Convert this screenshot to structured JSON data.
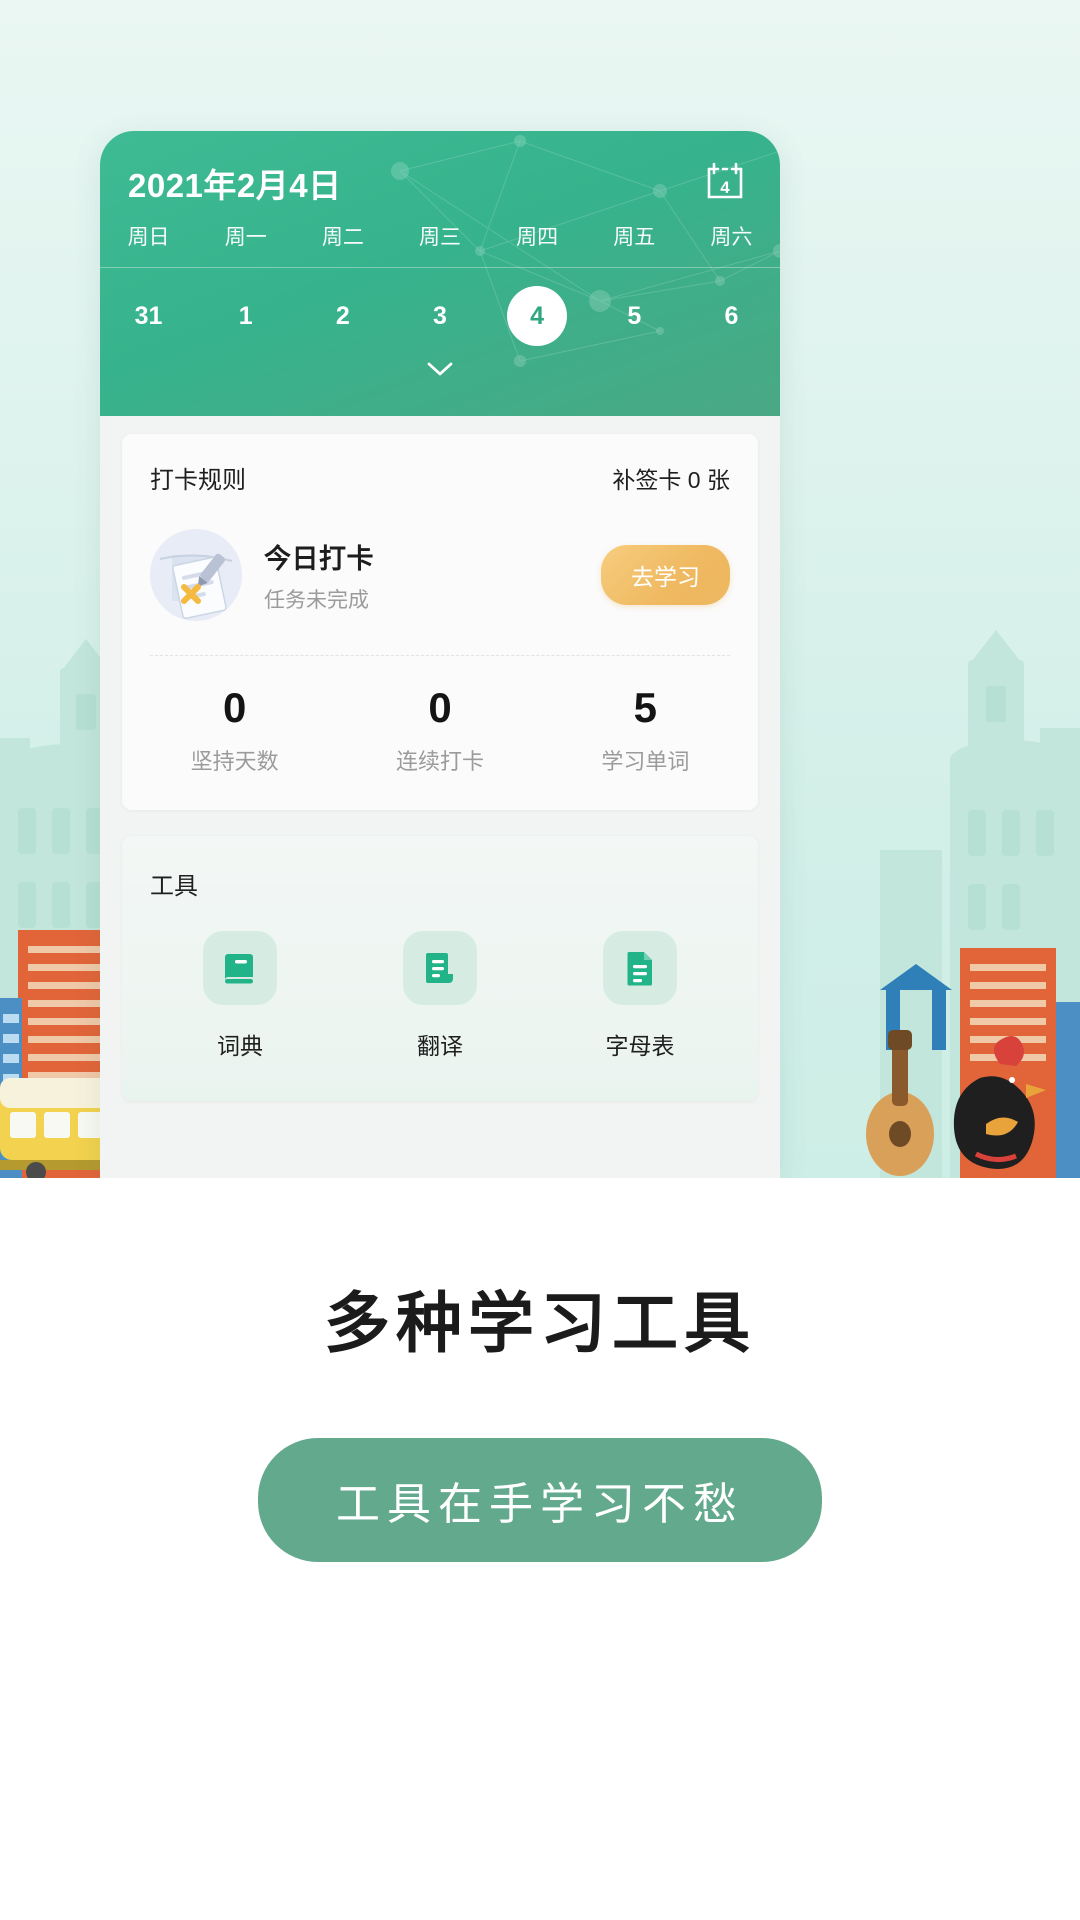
{
  "colors": {
    "header_green": "#36b38c",
    "accent_yellow": "#efb961",
    "tool_green": "#2fb98a",
    "promo_green": "#62a98e",
    "page_bg": "#f2f4f3"
  },
  "header": {
    "date_title": "2021年2月4日",
    "calendar_icon_label": "calendar-icon",
    "calendar_icon_day": "4",
    "weekdays": [
      "周日",
      "周一",
      "周二",
      "周三",
      "周四",
      "周五",
      "周六"
    ],
    "dates": [
      "31",
      "1",
      "2",
      "3",
      "4",
      "5",
      "6"
    ],
    "selected_index": 4,
    "expand_icon": "chevron-down-icon"
  },
  "checkin_card": {
    "rules_label": "打卡规则",
    "makeup_cards": "补签卡 0 张",
    "title": "今日打卡",
    "subtitle": "任务未完成",
    "action_label": "去学习",
    "stats": [
      {
        "value": "0",
        "label": "坚持天数"
      },
      {
        "value": "0",
        "label": "连续打卡"
      },
      {
        "value": "5",
        "label": "学习单词"
      }
    ]
  },
  "tools_card": {
    "title": "工具",
    "items": [
      {
        "name": "词典",
        "icon": "book-icon"
      },
      {
        "name": "翻译",
        "icon": "document-icon"
      },
      {
        "name": "字母表",
        "icon": "text-file-icon"
      }
    ]
  },
  "promo": {
    "headline": "多种学习工具",
    "pill_label": "工具在手学习不愁"
  }
}
